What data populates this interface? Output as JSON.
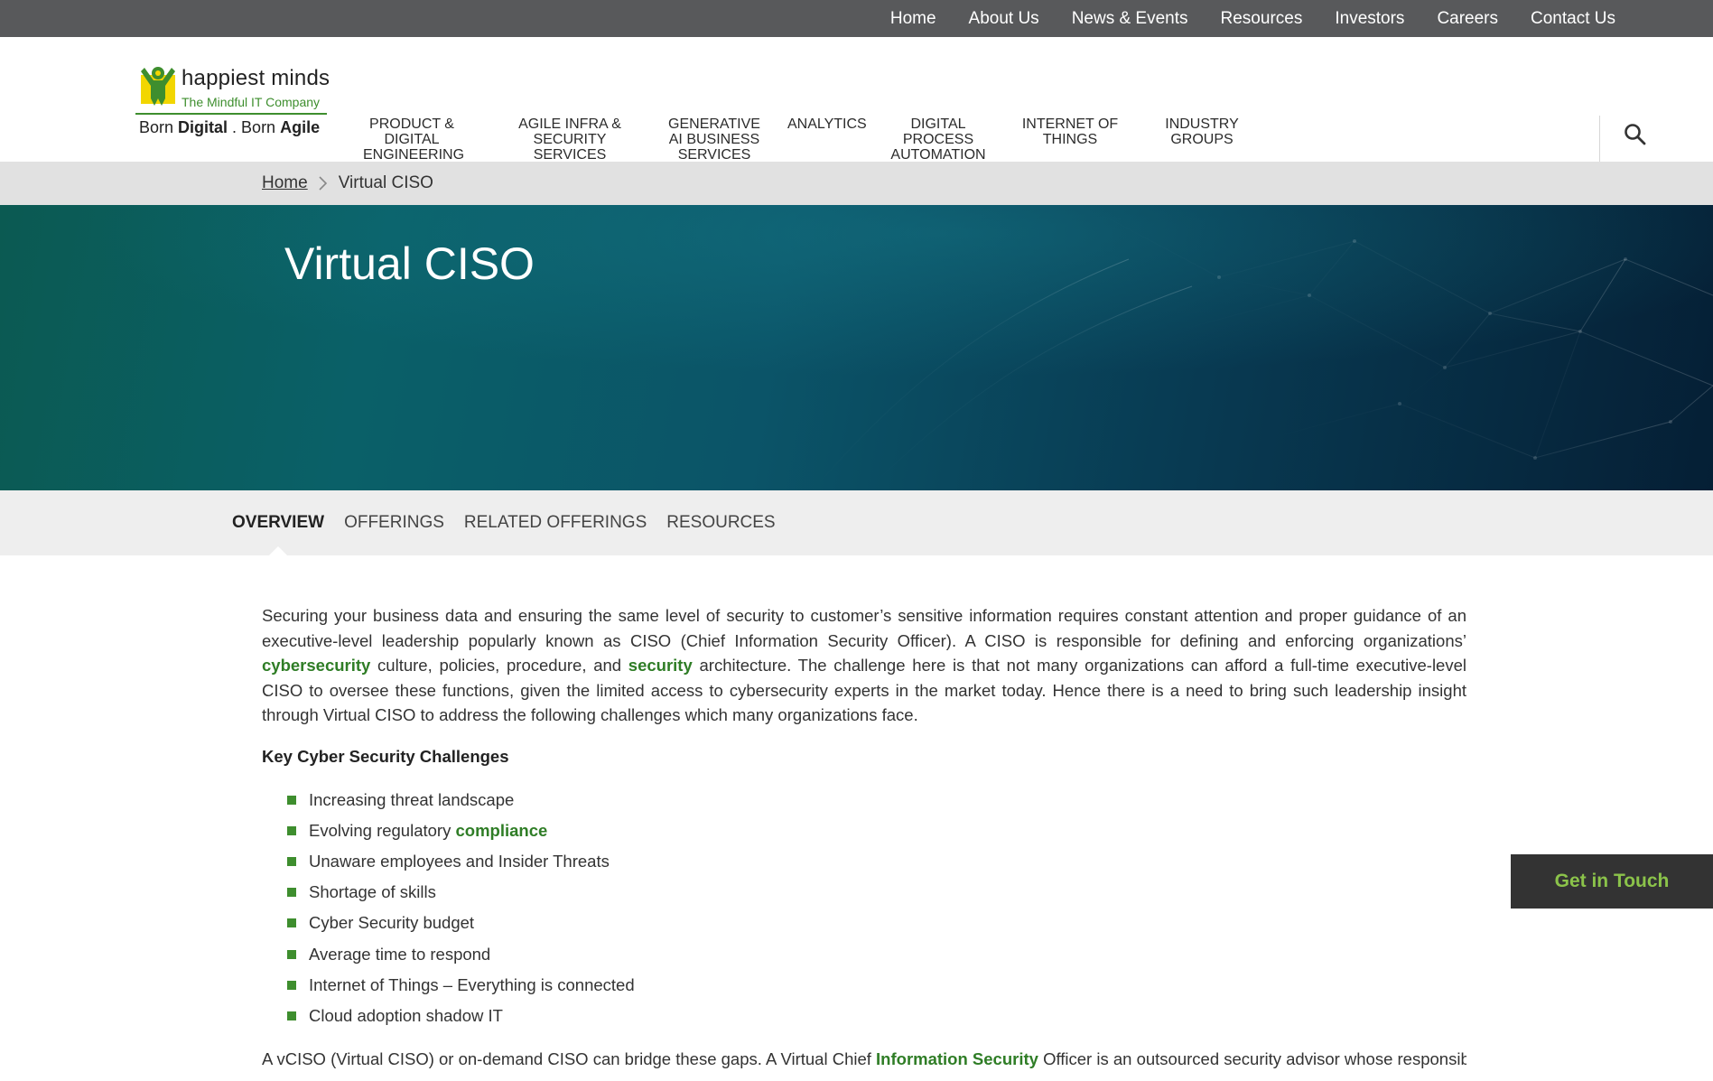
{
  "top_nav": [
    "Home",
    "About Us",
    "News & Events",
    "Resources",
    "Investors",
    "Careers",
    "Contact Us"
  ],
  "logo": {
    "name": "happiest minds",
    "tagline": "The Mindful IT Company",
    "slogan_part1": "Born ",
    "slogan_bold1": "Digital",
    "slogan_sep": " . Born ",
    "slogan_bold2": "Agile",
    "colors": {
      "green": "#3e8e2e",
      "yellow": "#f2d600"
    }
  },
  "main_nav": [
    {
      "label": "PRODUCT & DIGITAL ENGINEERING SERVICES"
    },
    {
      "label": "AGILE INFRA & SECURITY SERVICES"
    },
    {
      "label": "GENERATIVE AI BUSINESS SERVICES"
    },
    {
      "label": "ANALYTICS"
    },
    {
      "label": "DIGITAL PROCESS AUTOMATION"
    },
    {
      "label": "INTERNET OF THINGS"
    },
    {
      "label": "INDUSTRY GROUPS"
    }
  ],
  "search_icon": "search-icon",
  "breadcrumb": {
    "home": "Home",
    "current": "Virtual CISO"
  },
  "hero": {
    "title": "Virtual CISO"
  },
  "tabs": [
    {
      "label": "OVERVIEW",
      "active": true
    },
    {
      "label": "OFFERINGS",
      "active": false
    },
    {
      "label": "RELATED OFFERINGS",
      "active": false
    },
    {
      "label": "RESOURCES",
      "active": false
    }
  ],
  "content": {
    "intro_1": "Securing your business data and ensuring the same level of security to customer’s sensitive information requires constant attention and proper guidance of an executive-level leadership popularly known as CISO (Chief Information Security Officer). A CISO is responsible for defining and enforcing organizations’ ",
    "intro_link_1": "cybersecurity",
    "intro_2": " culture, policies, procedure, and ",
    "intro_link_2": "security",
    "intro_3": " architecture. The challenge here is that not many organizations can afford a full-time executive-level CISO to oversee these functions, given the limited access to cybersecurity experts in the market today. Hence there is a need to bring such leadership insight through Virtual CISO to address the following challenges which many organizations face.",
    "key_heading": "Key Cyber Security Challenges",
    "bullets": [
      "Increasing threat landscape",
      "Evolving regulatory ",
      "Unaware employees and Insider Threats",
      "Shortage of skills",
      "Cyber Security budget",
      "Average time to respond",
      "Internet of Things – Everything is connected",
      "Cloud adoption shadow IT"
    ],
    "bullet_link": "compliance",
    "outro_1": "A vCISO (Virtual CISO) or on-demand CISO can bridge these gaps. A Virtual Chief ",
    "outro_link": "Information Security",
    "outro_2": " Officer is an outsourced security advisor whose responsibilities"
  },
  "cta": {
    "label": "Get in Touch",
    "color": "#8bc34a"
  }
}
